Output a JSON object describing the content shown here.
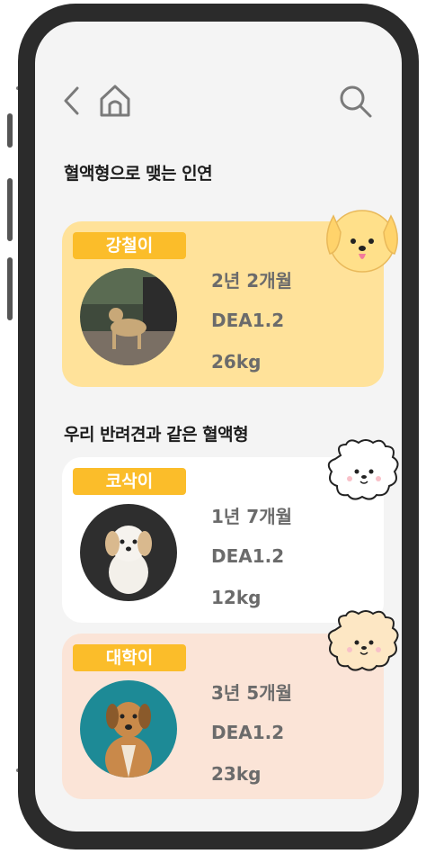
{
  "header": {
    "back_icon": "chevron-left-icon",
    "home_icon": "home-icon",
    "search_icon": "search-icon"
  },
  "sections": {
    "matched_title": "혈액형으로 맺는 인연",
    "same_type_title": "우리 반려견과 같은 혈액형"
  },
  "dogs": [
    {
      "name": "강철이",
      "age": "2년 2개월",
      "blood_type": "DEA1.2",
      "weight": "26kg",
      "card_color": "#ffe29a"
    },
    {
      "name": "코삭이",
      "age": "1년 7개월",
      "blood_type": "DEA1.2",
      "weight": "12kg",
      "card_color": "#ffffff"
    },
    {
      "name": "대학이",
      "age": "3년 5개월",
      "blood_type": "DEA1.2",
      "weight": "23kg",
      "card_color": "#fbe4d7"
    }
  ],
  "colors": {
    "name_tag": "#fbbd2a",
    "info_text": "#6b6b6b",
    "screen_bg": "#f4f4f4",
    "phone_frame": "#2b2b2b"
  }
}
